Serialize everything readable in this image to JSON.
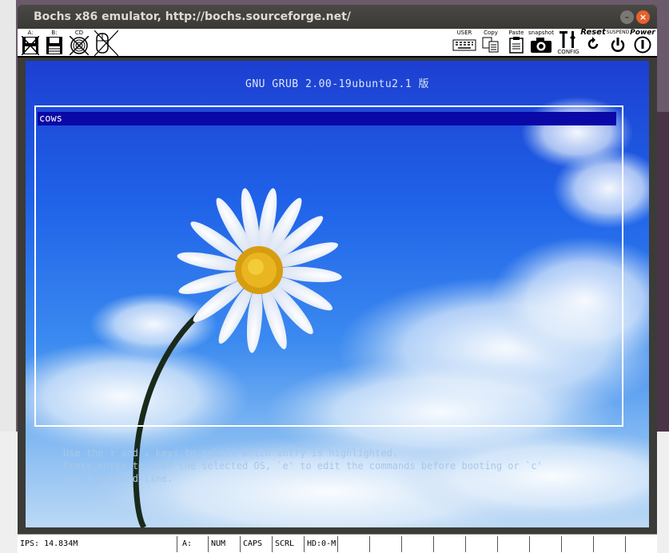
{
  "window": {
    "title": "Bochs x86 emulator, http://bochs.sourceforge.net/",
    "minimize_glyph": "–",
    "close_glyph": "×"
  },
  "toolbar": {
    "floppy_a_label": "A:",
    "floppy_b_label": "B:",
    "cdrom_label": "CD",
    "user_label": "USER",
    "copy_label": "Copy",
    "paste_label": "Paste",
    "snapshot_label": "snapshot",
    "config_label": "CONFIG",
    "reset_label": "Reset",
    "suspend_label": "SUSPEND",
    "power_label": "Power"
  },
  "grub": {
    "header": "GNU GRUB  2.00-19ubuntu2.1 版",
    "entries": [
      "cows"
    ],
    "selected_entry": "cows",
    "help_lines": [
      "Use the ↑ and ↓ keys to select which entry is highlighted.",
      "Press enter to boot the selected OS, `e' to edit the commands before booting or `c'",
      "for a command-line."
    ]
  },
  "statusbar": {
    "ips": "IPS: 14.834M",
    "drive": "A:",
    "num": "NUM",
    "caps": "CAPS",
    "scrl": "SCRL",
    "hd": "HD:0-M"
  },
  "colors": {
    "selection": "#0a08a6",
    "close_button": "#e7602c",
    "titlebar": "#3b3b38"
  }
}
